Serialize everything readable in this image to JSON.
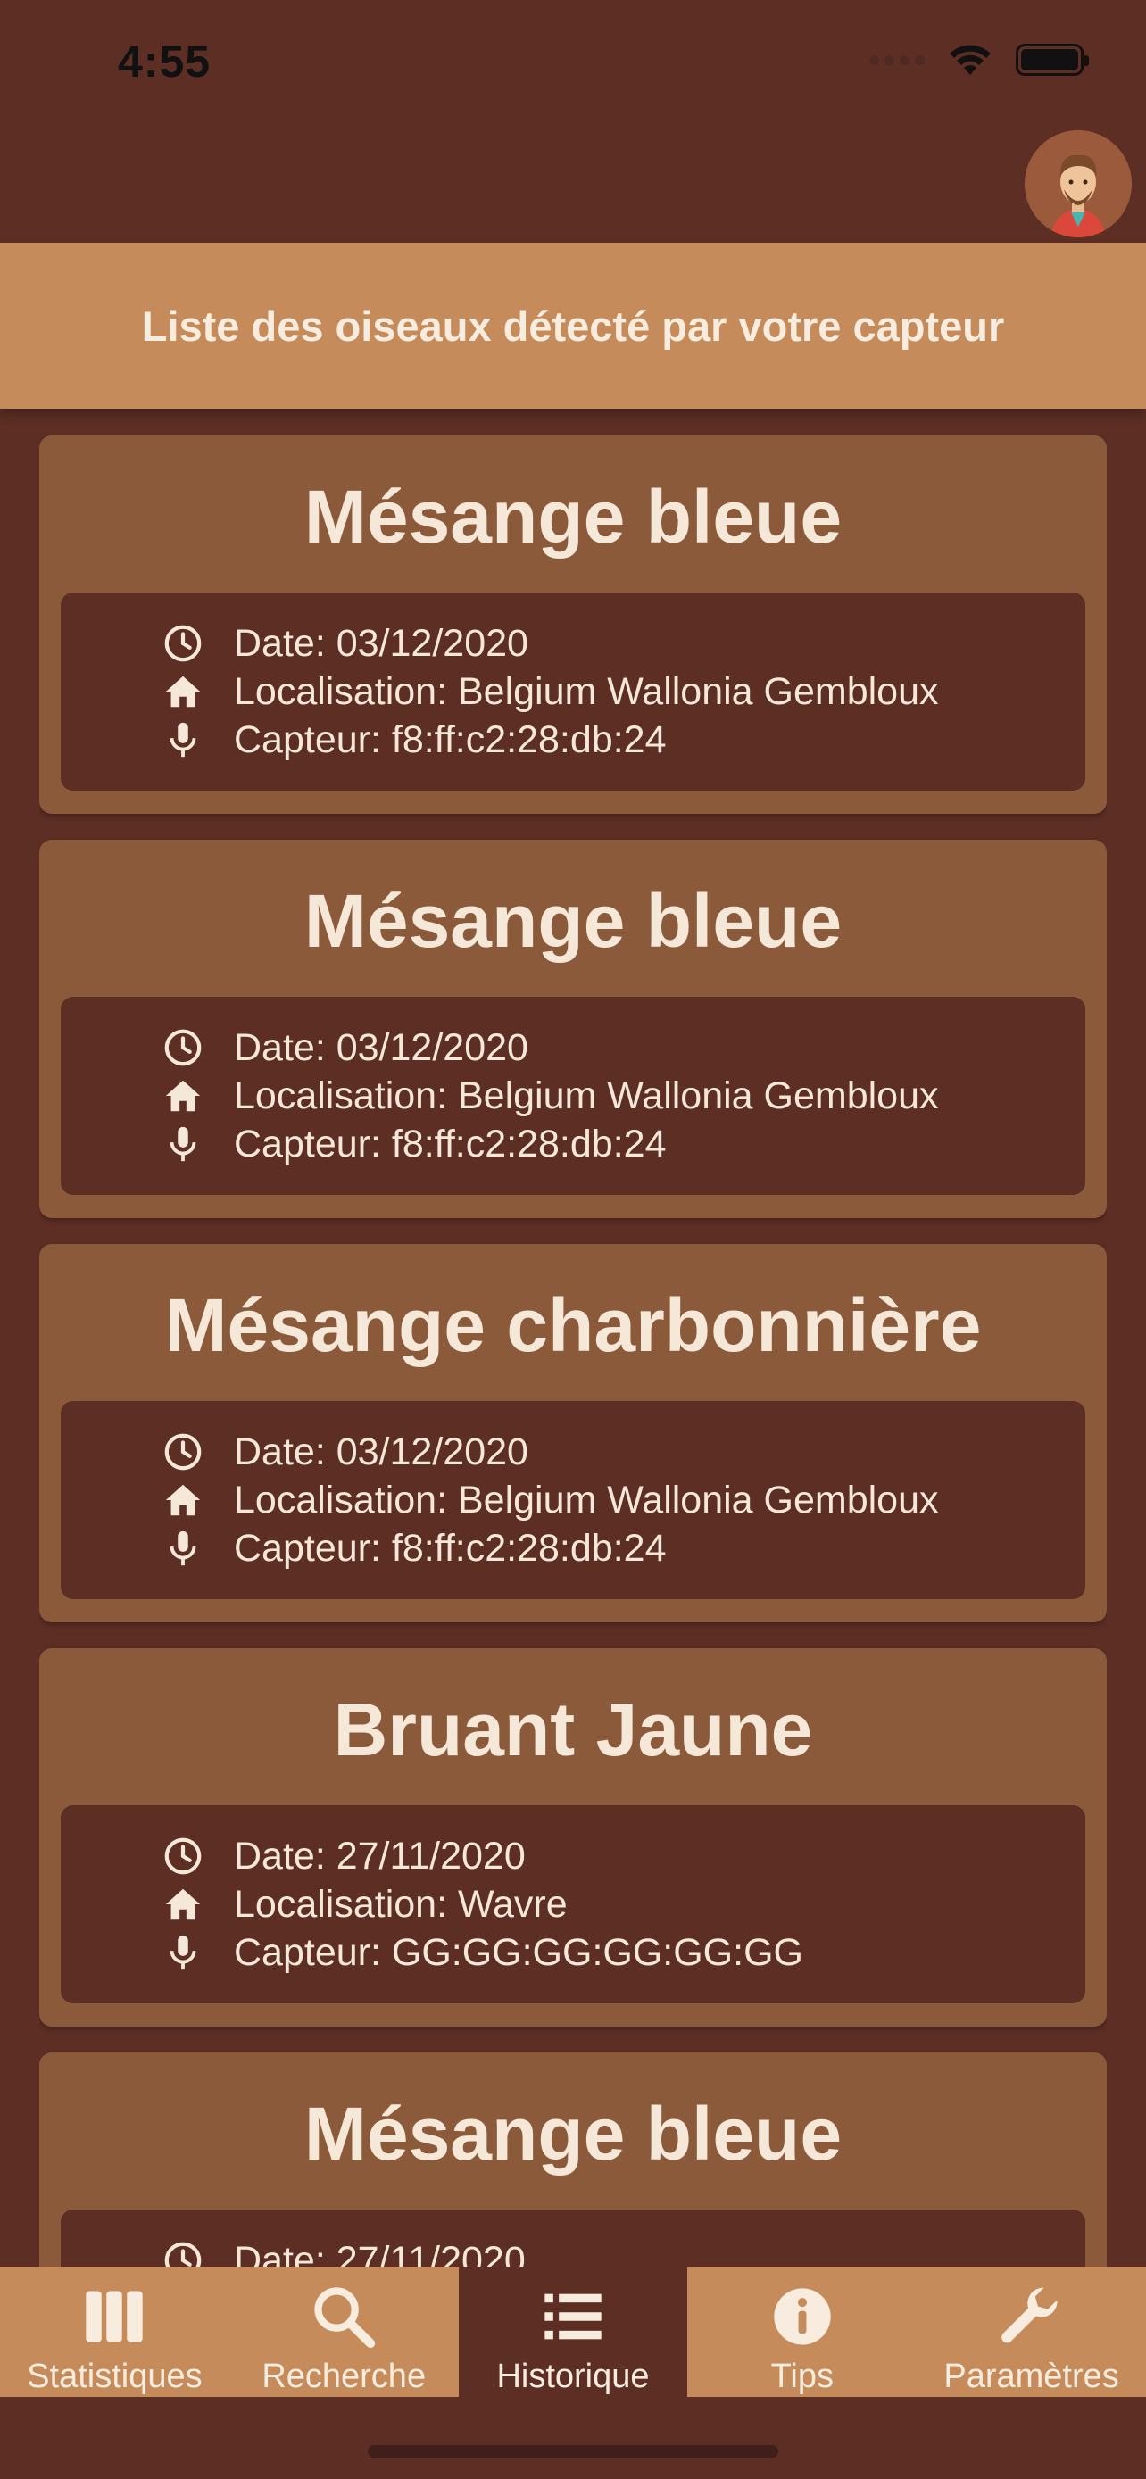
{
  "status_bar": {
    "time": "4:55"
  },
  "header": {
    "title": "Liste des oiseaux détecté par votre capteur"
  },
  "detections": [
    {
      "name": "Mésange bleue",
      "date": "Date: 03/12/2020",
      "location": "Localisation: Belgium Wallonia Gembloux",
      "sensor": "Capteur: f8:ff:c2:28:db:24"
    },
    {
      "name": "Mésange bleue",
      "date": "Date: 03/12/2020",
      "location": "Localisation: Belgium Wallonia Gembloux",
      "sensor": "Capteur: f8:ff:c2:28:db:24"
    },
    {
      "name": "Mésange charbonnière",
      "date": "Date: 03/12/2020",
      "location": "Localisation: Belgium Wallonia Gembloux",
      "sensor": "Capteur: f8:ff:c2:28:db:24"
    },
    {
      "name": "Bruant Jaune",
      "date": "Date: 27/11/2020",
      "location": "Localisation: Wavre",
      "sensor": "Capteur: GG:GG:GG:GG:GG:GG"
    },
    {
      "name": "Mésange bleue",
      "date": "Date: 27/11/2020",
      "location": "",
      "sensor": ""
    }
  ],
  "tabs": [
    {
      "label": "Statistiques",
      "icon": "bar-chart-icon",
      "active": false
    },
    {
      "label": "Recherche",
      "icon": "search-icon",
      "active": false
    },
    {
      "label": "Historique",
      "icon": "list-icon",
      "active": true
    },
    {
      "label": "Tips",
      "icon": "info-icon",
      "active": false
    },
    {
      "label": "Paramètres",
      "icon": "wrench-icon",
      "active": false
    }
  ],
  "colors": {
    "background": "#5c2e24",
    "card": "#8b5a3a",
    "accent": "#c68b5b",
    "text": "#f6e8d8"
  }
}
